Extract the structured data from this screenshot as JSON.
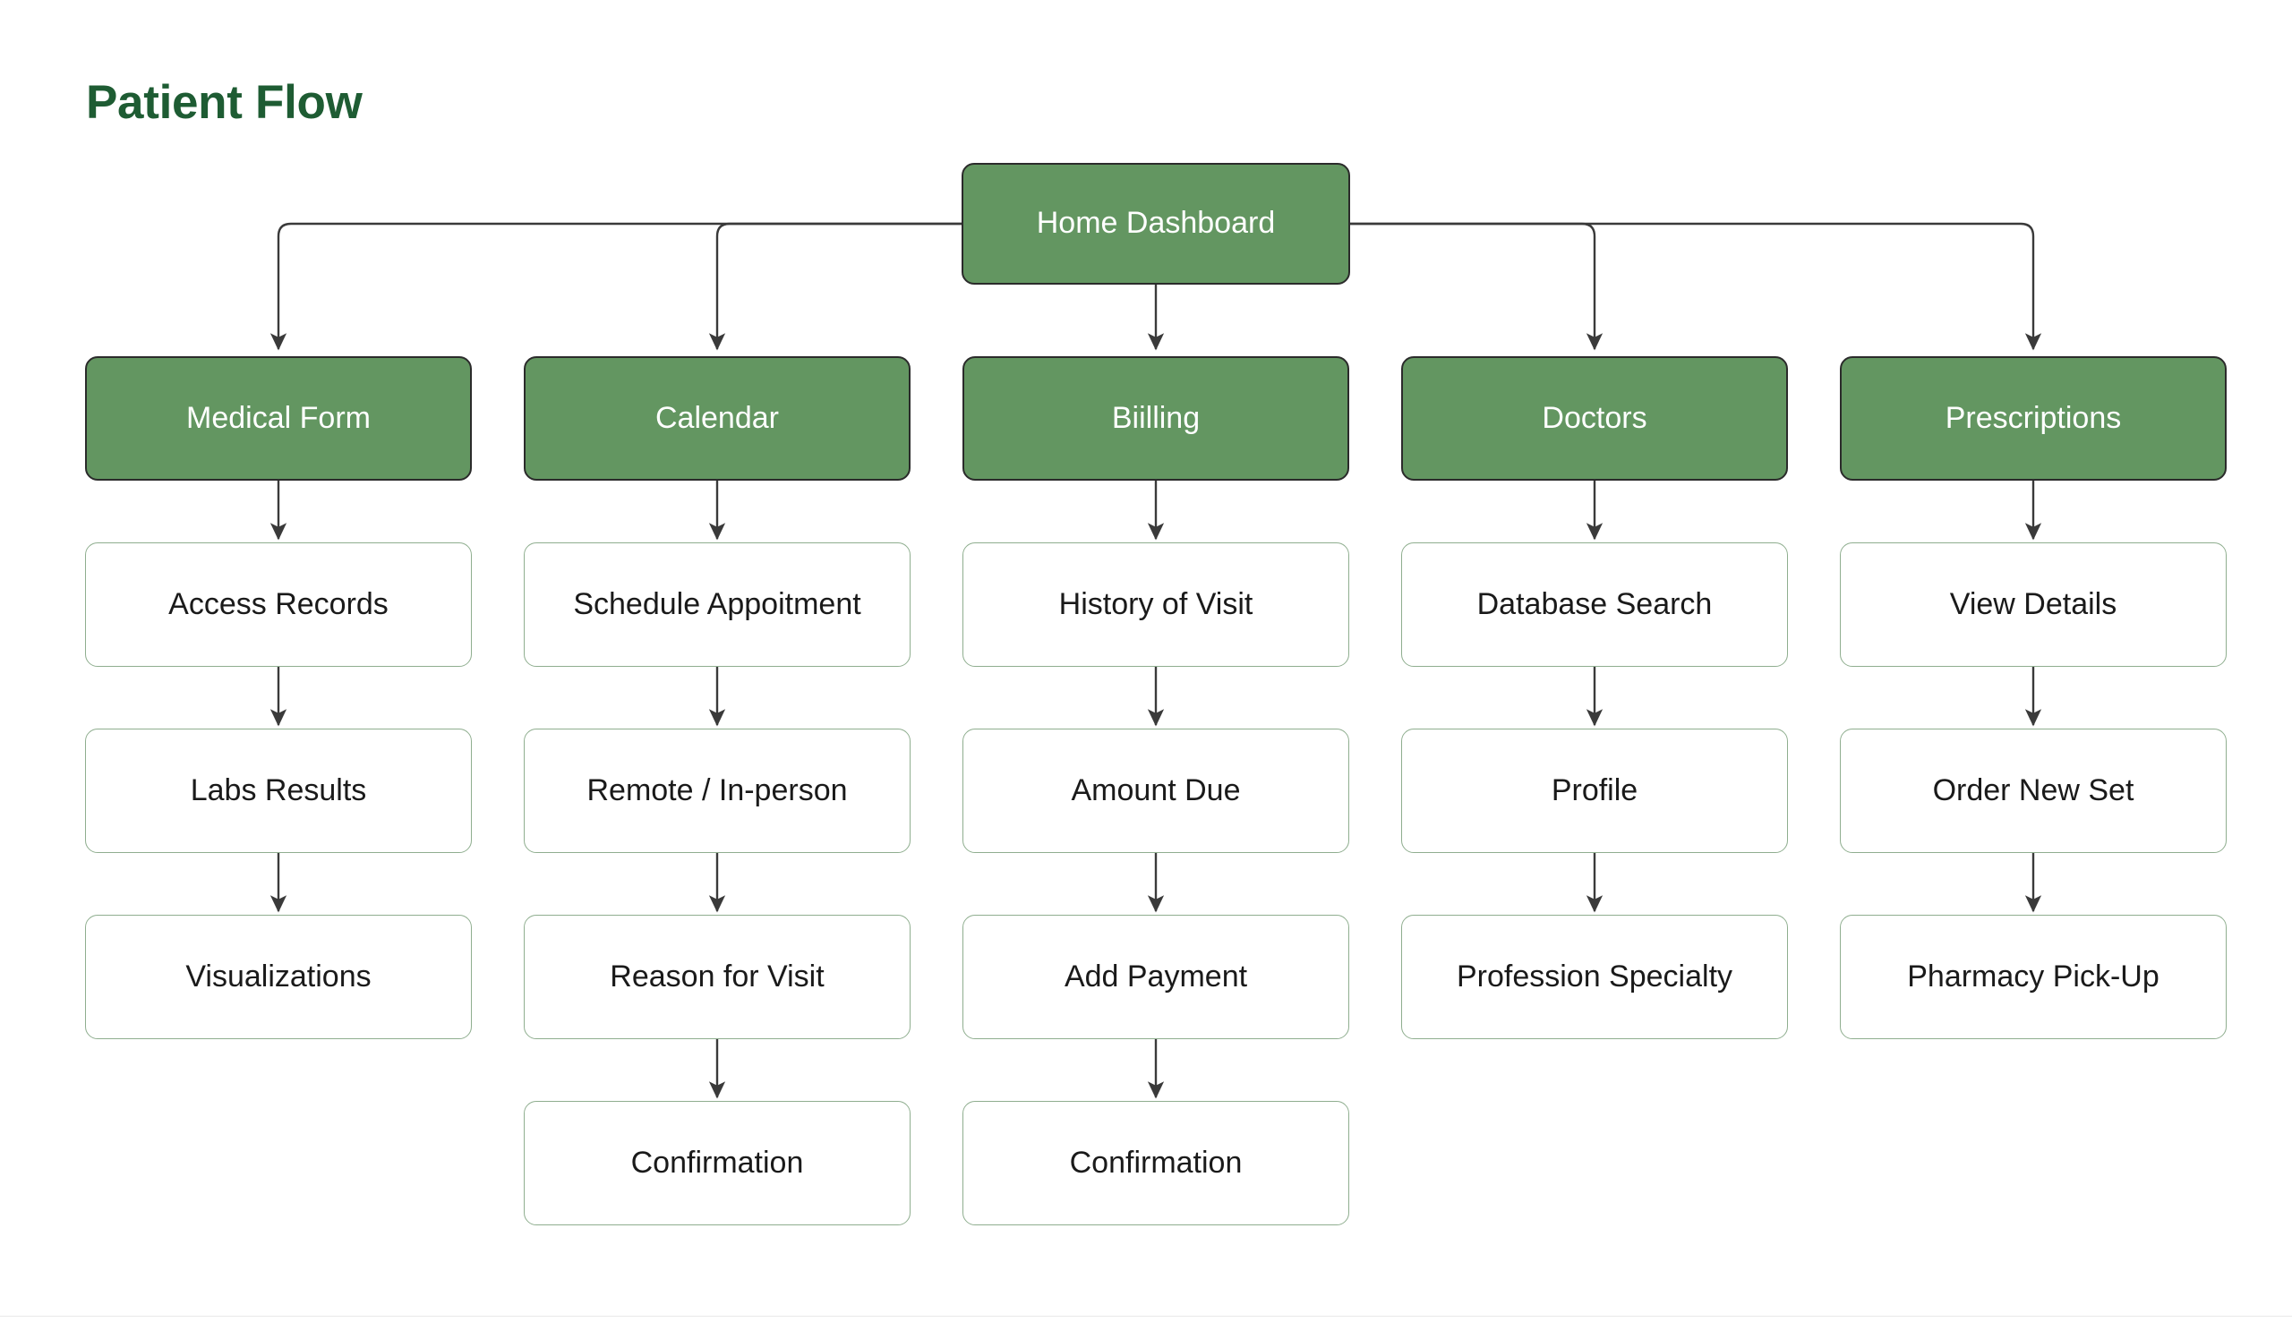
{
  "title": "Patient Flow",
  "theme": {
    "title_color": "#1e5c33",
    "node_green_fill": "#639661",
    "node_green_text": "#ffffff",
    "node_green_border": "#2b2b2b",
    "node_white_fill": "#ffffff",
    "node_white_text": "#1a1a1a",
    "node_white_border": "#8fae8f",
    "connector_color": "#3a3a3a",
    "background": "#ffffff"
  },
  "chart_data": {
    "type": "diagram",
    "subtype": "flowchart-tree",
    "title": "Patient Flow",
    "orientation": "top-down",
    "root": "Home Dashboard",
    "branches": [
      {
        "category": "Medical Form",
        "steps": [
          "Access Records",
          "Labs Results",
          "Visualizations"
        ]
      },
      {
        "category": "Calendar",
        "steps": [
          "Schedule Appoitment",
          "Remote / In-person",
          "Reason for Visit",
          "Confirmation"
        ]
      },
      {
        "category": "Biilling",
        "steps": [
          "History of Visit",
          "Amount Due",
          "Add Payment",
          "Confirmation"
        ]
      },
      {
        "category": "Doctors",
        "steps": [
          "Database Search",
          "Profile",
          "Profession Specialty"
        ]
      },
      {
        "category": "Prescriptions",
        "steps": [
          "View Details",
          "Order New Set",
          "Pharmacy Pick-Up"
        ]
      }
    ],
    "edges": [
      {
        "from": "Home Dashboard",
        "to": "Medical Form"
      },
      {
        "from": "Home Dashboard",
        "to": "Calendar"
      },
      {
        "from": "Home Dashboard",
        "to": "Biilling"
      },
      {
        "from": "Home Dashboard",
        "to": "Doctors"
      },
      {
        "from": "Home Dashboard",
        "to": "Prescriptions"
      },
      {
        "from": "Medical Form",
        "to": "Access Records"
      },
      {
        "from": "Access Records",
        "to": "Labs Results"
      },
      {
        "from": "Labs Results",
        "to": "Visualizations"
      },
      {
        "from": "Calendar",
        "to": "Schedule Appoitment"
      },
      {
        "from": "Schedule Appoitment",
        "to": "Remote / In-person"
      },
      {
        "from": "Remote / In-person",
        "to": "Reason for Visit"
      },
      {
        "from": "Reason for Visit",
        "to": "Confirmation"
      },
      {
        "from": "Biilling",
        "to": "History of Visit"
      },
      {
        "from": "History of Visit",
        "to": "Amount Due"
      },
      {
        "from": "Amount Due",
        "to": "Add Payment"
      },
      {
        "from": "Add Payment",
        "to": "Confirmation"
      },
      {
        "from": "Doctors",
        "to": "Database Search"
      },
      {
        "from": "Database Search",
        "to": "Profile"
      },
      {
        "from": "Profile",
        "to": "Profession Specialty"
      },
      {
        "from": "Prescriptions",
        "to": "View Details"
      },
      {
        "from": "View Details",
        "to": "Order New Set"
      },
      {
        "from": "Order New Set",
        "to": "Pharmacy Pick-Up"
      }
    ]
  },
  "nodes": {
    "root": "Home Dashboard",
    "c0r0": "Medical Form",
    "c0r1": "Access Records",
    "c0r2": "Labs Results",
    "c0r3": "Visualizations",
    "c1r0": "Calendar",
    "c1r1": "Schedule Appoitment",
    "c1r2": "Remote / In-person",
    "c1r3": "Reason for Visit",
    "c1r4": "Confirmation",
    "c2r0": "Biilling",
    "c2r1": "History of Visit",
    "c2r2": "Amount Due",
    "c2r3": "Add Payment",
    "c2r4": "Confirmation",
    "c3r0": "Doctors",
    "c3r1": "Database Search",
    "c3r2": "Profile",
    "c3r3": "Profession Specialty",
    "c4r0": "Prescriptions",
    "c4r1": "View Details",
    "c4r2": "Order New Set",
    "c4r3": "Pharmacy Pick-Up"
  }
}
